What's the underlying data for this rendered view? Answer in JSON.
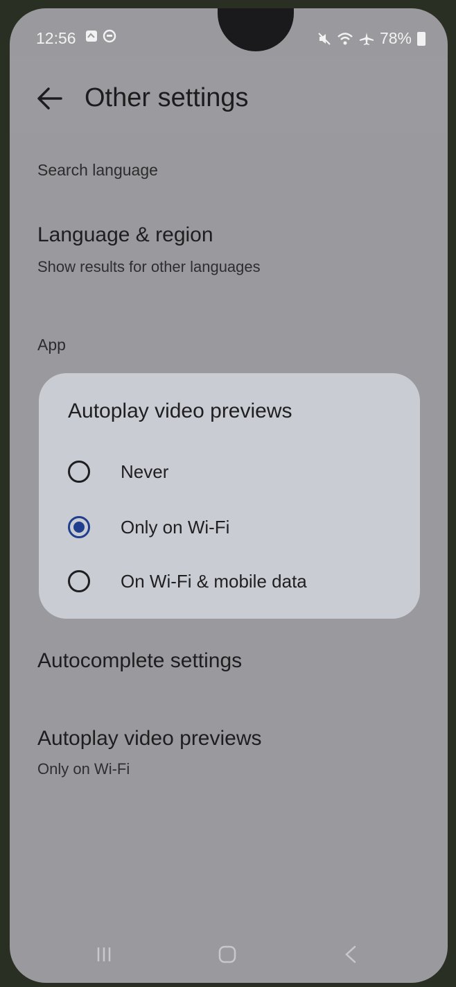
{
  "status": {
    "time": "12:56",
    "battery": "78%"
  },
  "header": {
    "title": "Other settings"
  },
  "sections": {
    "search_language": "Search language",
    "language_region_title": "Language & region",
    "language_region_sub": "Show results for other languages",
    "app": "App",
    "autocomplete": "Autocomplete settings",
    "autoplay_title": "Autoplay video previews",
    "autoplay_sub": "Only on Wi-Fi"
  },
  "dialog": {
    "title": "Autoplay video previews",
    "options": [
      {
        "label": "Never",
        "selected": false
      },
      {
        "label": "Only on Wi-Fi",
        "selected": true
      },
      {
        "label": "On Wi-Fi & mobile data",
        "selected": false
      }
    ]
  },
  "nav": {
    "icons": [
      "recents-icon",
      "home-icon",
      "back-icon"
    ]
  },
  "colors": {
    "accent": "#1f3f8e",
    "scrim": "#9a9a9e",
    "dialog": "#c9ccd3"
  }
}
